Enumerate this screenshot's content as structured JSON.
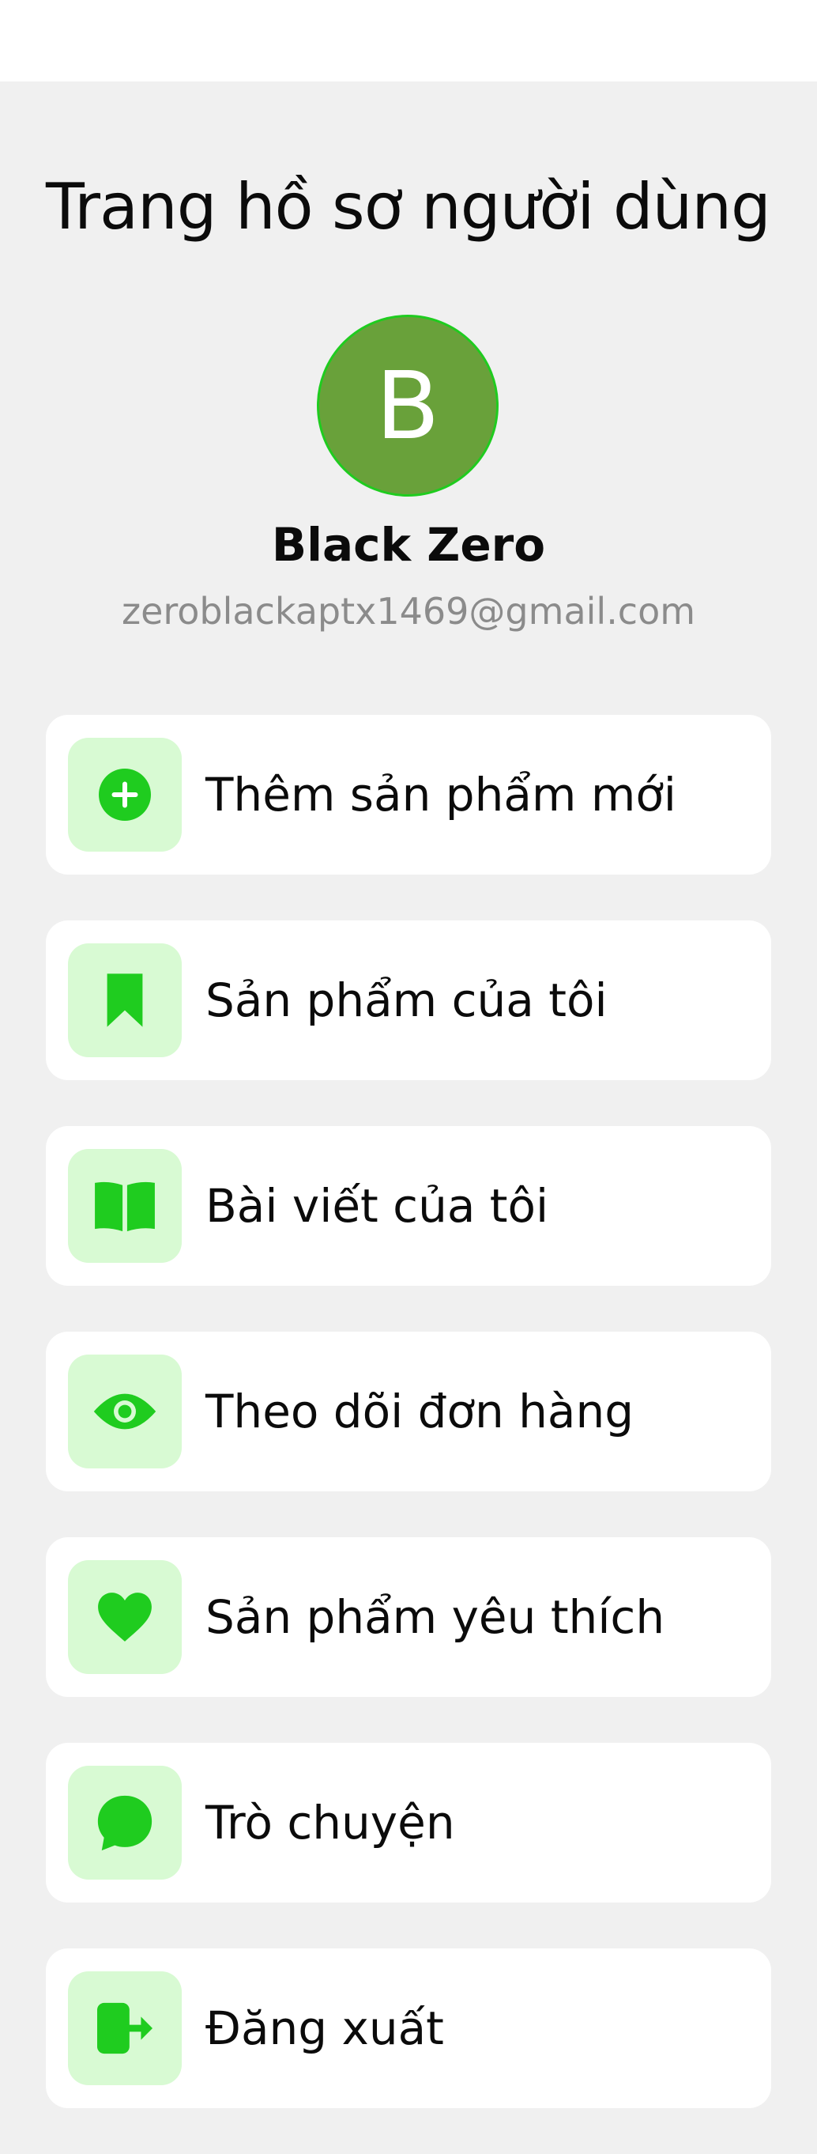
{
  "header": {
    "title": "Trang hồ sơ người dùng"
  },
  "profile": {
    "avatar_letter": "B",
    "name": "Black Zero",
    "email": "zeroblackaptx1469@gmail.com"
  },
  "menu": {
    "items": [
      {
        "label": "Thêm sản phẩm mới",
        "icon": "plus-circle-icon"
      },
      {
        "label": "Sản phẩm của tôi",
        "icon": "bookmark-icon"
      },
      {
        "label": "Bài viết của tôi",
        "icon": "book-open-icon"
      },
      {
        "label": "Theo dõi đơn hàng",
        "icon": "eye-icon"
      },
      {
        "label": "Sản phẩm yêu thích",
        "icon": "heart-icon"
      },
      {
        "label": "Trò chuyện",
        "icon": "chat-bubble-icon"
      },
      {
        "label": "Đăng xuất",
        "icon": "logout-icon"
      }
    ]
  },
  "colors": {
    "accent": "#1fcc1f",
    "icon_bg": "#d8fad3",
    "avatar_bg": "#69a13a",
    "page_bg": "#f0f0f0"
  }
}
